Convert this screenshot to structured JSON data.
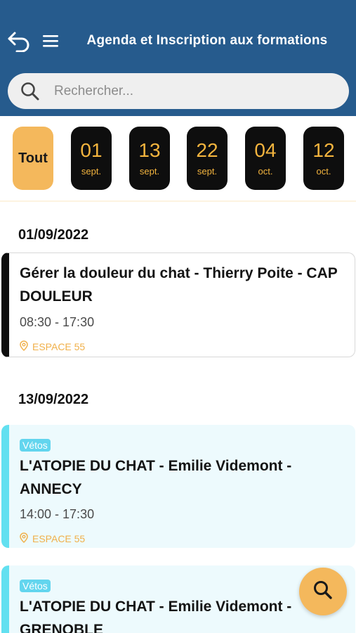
{
  "header": {
    "title": "Agenda et Inscription aux formations",
    "background": "#265b8d"
  },
  "search": {
    "placeholder": "Rechercher..."
  },
  "date_filter": {
    "all_label": "Tout",
    "dates": [
      {
        "day": "01",
        "month": "sept."
      },
      {
        "day": "13",
        "month": "sept."
      },
      {
        "day": "22",
        "month": "sept."
      },
      {
        "day": "04",
        "month": "oct."
      },
      {
        "day": "12",
        "month": "oct."
      }
    ],
    "accent_color": "#f4b85c"
  },
  "groups": [
    {
      "date": "01/09/2022",
      "events": [
        {
          "tag": "",
          "title": "Gérer la douleur du chat - Thierry Poite - CAP DOULEUR",
          "time": "08:30 - 17:30",
          "location": "ESPACE 55"
        }
      ]
    },
    {
      "date": "13/09/2022",
      "events": [
        {
          "tag": "Vétos",
          "title": "L'ATOPIE DU CHAT - Emilie Videmont - ANNECY",
          "time": "14:00 - 17:30",
          "location": "ESPACE 55"
        },
        {
          "tag": "Vétos",
          "title": "L'ATOPIE DU CHAT - Emilie Videmont - GRENOBLE",
          "time": "",
          "location": ""
        }
      ]
    }
  ],
  "icons": {
    "back": "back-arrow-icon",
    "menu": "hamburger-menu-icon",
    "search": "search-icon",
    "location": "location-pin-icon",
    "fab": "search-icon"
  }
}
